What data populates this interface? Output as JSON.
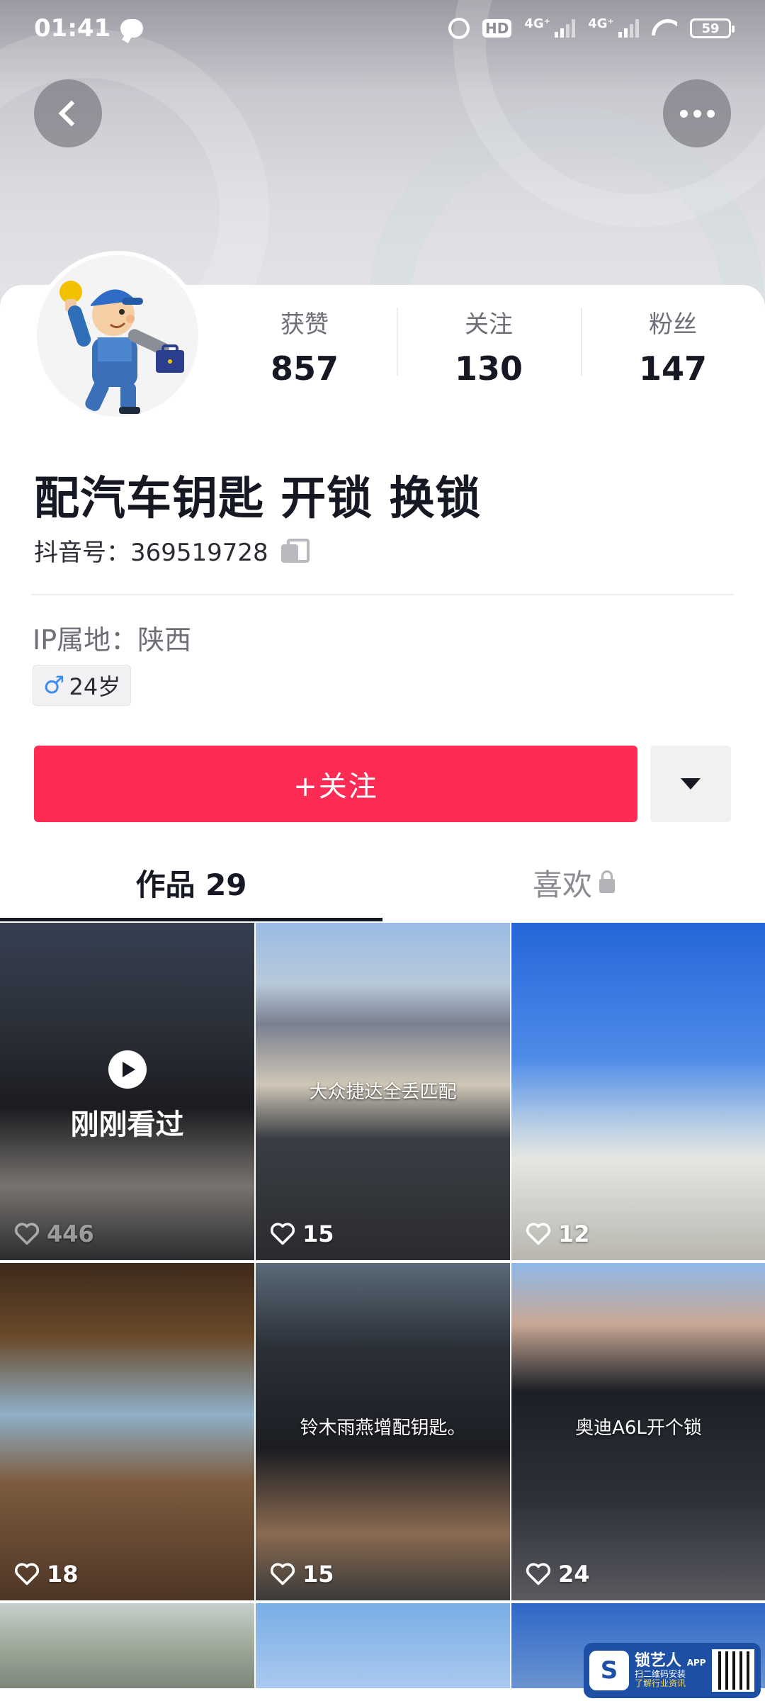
{
  "status_bar": {
    "time": "01:41",
    "hd_label": "HD",
    "net1": "4G⁺",
    "net2": "4G⁺",
    "battery": "59"
  },
  "header": {
    "back_icon": "chevron-left-icon",
    "more_icon": "more-dots-icon"
  },
  "profile": {
    "stats": [
      {
        "label": "获赞",
        "value": "857"
      },
      {
        "label": "关注",
        "value": "130"
      },
      {
        "label": "粉丝",
        "value": "147"
      }
    ],
    "nickname": "配汽车钥匙 开锁 换锁",
    "douyin_id": "抖音号：369519728",
    "ip_location": "IP属地：陕西",
    "gender_icon": "♂",
    "age": "24岁"
  },
  "actions": {
    "follow_label": "+关注"
  },
  "tabs": {
    "works": "作品 29",
    "likes": "喜欢"
  },
  "videos": [
    {
      "likes": "446",
      "watched_label": "刚刚看过",
      "caption": ""
    },
    {
      "likes": "15",
      "caption": "大众捷达全丢匹配"
    },
    {
      "likes": "12",
      "caption": ""
    },
    {
      "likes": "18",
      "caption": ""
    },
    {
      "likes": "15",
      "caption": "铃木雨燕增配钥匙。"
    },
    {
      "likes": "24",
      "caption": "奥迪A6L开个锁"
    }
  ],
  "watermark": {
    "title": "锁艺人",
    "tag": "APP",
    "line1": "扫二维码安装",
    "line2": "了解行业资讯"
  },
  "colors": {
    "accent": "#fe2c55",
    "text": "#161823"
  }
}
